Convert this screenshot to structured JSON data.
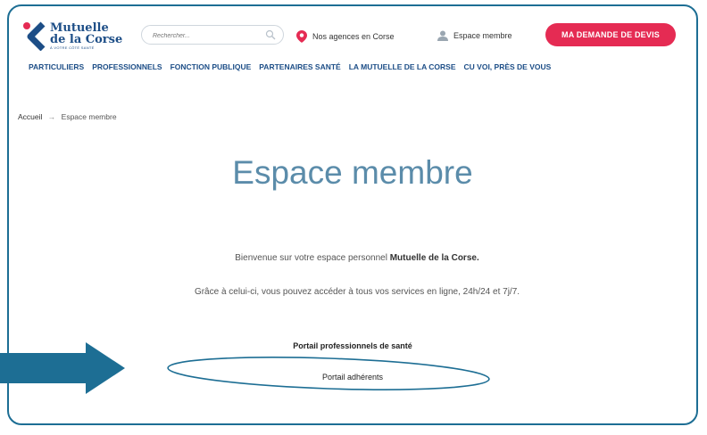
{
  "header": {
    "logo_line1": "Mutuelle",
    "logo_line2": "de la Corse",
    "logo_tagline": "À VOTRE CÔTÉ SANTÉ",
    "search_placeholder": "Rechercher...",
    "agencies_label": "Nos agences en Corse",
    "member_label": "Espace membre",
    "cta_label": "MA DEMANDE DE DEVIS"
  },
  "nav": {
    "items": [
      "PARTICULIERS",
      "PROFESSIONNELS",
      "FONCTION PUBLIQUE",
      "PARTENAIRES SANTÉ",
      "LA MUTUELLE DE LA CORSE",
      "CU VOI, PRÈS DE VOUS"
    ]
  },
  "breadcrumb": {
    "home": "Accueil",
    "separator": "→",
    "current": "Espace membre"
  },
  "main": {
    "title": "Espace membre",
    "welcome_prefix": "Bienvenue sur votre espace personnel ",
    "welcome_brand": "Mutuelle de la Corse.",
    "services_text": "Grâce à celui-ci, vous pouvez accéder à tous vos services en ligne, 24h/24 et 7j/7.",
    "link_pros": "Portail professionnels de santé",
    "link_members": "Portail adhérents"
  },
  "colors": {
    "frame": "#1d6e94",
    "brand_blue": "#1d4e87",
    "cta": "#e52b53",
    "title": "#5b8caa",
    "annotation": "#1d6e94"
  }
}
